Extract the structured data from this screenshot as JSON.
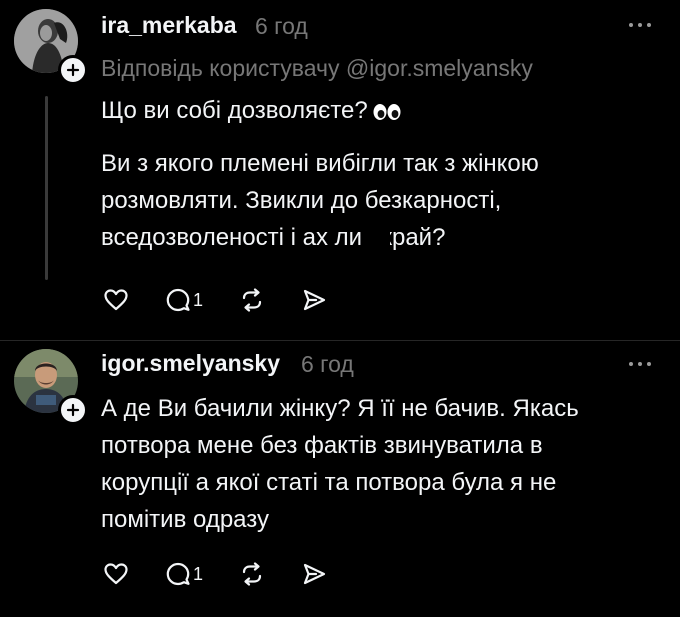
{
  "posts": [
    {
      "username": "ira_merkaba",
      "time": "6 год",
      "reply_to_prefix": "Відповідь користувачу",
      "reply_to_handle": "@igor.smelyansky",
      "paragraphs": [
        "Що ви собі дозволяєте?",
        "Ви з якого племені вибігли так з жінкою",
        "розмовляти. Звикли до безкарності,",
        "вседозволеності і ах   ли вкрай?"
      ],
      "comment_count": "1"
    },
    {
      "username": "igor.smelyansky",
      "time": "6 год",
      "paragraphs": [
        "А де Ви бачили жінку? Я її не бачив. Якась",
        "потвора мене без фактів звинуватила в",
        "корупції а якої статі та потвора була я не",
        "помітив одразу"
      ],
      "comment_count": "1"
    }
  ],
  "colors": {
    "background": "#000000",
    "text": "#f3f5f7",
    "secondary": "#777777"
  },
  "icons": [
    "heart-icon",
    "comment-icon",
    "repost-icon",
    "share-icon",
    "more-icon",
    "plus-icon",
    "eyes-emoji"
  ]
}
